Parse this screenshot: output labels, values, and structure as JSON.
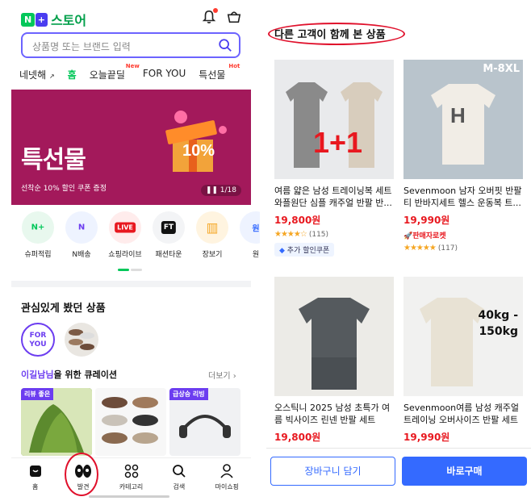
{
  "left": {
    "logo": {
      "badge": "N",
      "plus": "+",
      "text": "스토어"
    },
    "search": {
      "placeholder": "상품명 또는 브랜드 입력"
    },
    "tabs": [
      {
        "label": "네넷해",
        "active": false
      },
      {
        "label": "홈",
        "active": true
      },
      {
        "label": "오늘끝딜",
        "sup": "New",
        "active": false
      },
      {
        "label": "FOR YOU",
        "active": false
      },
      {
        "label": "특선물",
        "sup": "Hot",
        "active": false
      }
    ],
    "banner": {
      "title": "특선물",
      "subtitle": "선착순 10% 할인 쿠폰 증정",
      "pager": "1/18",
      "badge": "10%"
    },
    "quick": [
      {
        "icon": "N+",
        "label": "슈퍼적립"
      },
      {
        "icon": "N",
        "label": "N배송"
      },
      {
        "icon": "LIVE",
        "label": "쇼핑라이브"
      },
      {
        "icon": "FT",
        "label": "패션타운"
      },
      {
        "icon": "cart-icon",
        "label": "장보기"
      },
      {
        "icon": "원",
        "label": "원"
      }
    ],
    "section_title": "관심있게 봤던 상품",
    "foryou_label": "FOR YOU",
    "curation": {
      "name": "이길남님",
      "rest": "을 위한 큐레이션",
      "more": "더보기 ›"
    },
    "cards": [
      {
        "tag": "리뷰 좋은"
      },
      {
        "tag": ""
      },
      {
        "tag": "급상승 리빙"
      }
    ],
    "bottom_nav": [
      {
        "icon": "home-icon",
        "label": "홈"
      },
      {
        "icon": "eyes-icon",
        "label": "발견"
      },
      {
        "icon": "category-icon",
        "label": "카테고리"
      },
      {
        "icon": "search-icon",
        "label": "검색"
      },
      {
        "icon": "user-icon",
        "label": "마이쇼핑"
      }
    ]
  },
  "right": {
    "title": "다른 고객이 함께 본 상품",
    "products": [
      {
        "name": "여름 얇은 남성 트레이닝복 세트 와플원단 심플 캐주얼 반팔 반...",
        "price": "19,800원",
        "stars": "★★★★☆",
        "reviews": "(115)",
        "extra": "추가 할인쿠폰",
        "overlay": "1+1"
      },
      {
        "name": "Sevenmoon 남자 오버핏 반팔티 반바지세트 헬스 운동복 트...",
        "price": "19,990원",
        "rocket": "🚀판매자로켓",
        "stars": "★★★★★",
        "reviews": "(117)",
        "overlay": "M-8XL"
      },
      {
        "name": "오스틱니 2025 남성 초특가 여름 빅사이즈 린넨 반팔 세트",
        "price": "19,800원"
      },
      {
        "name": "Sevenmoon여름 남성 캐주얼 트레이닝 오버사이즈 반팔 세트",
        "price": "19,990원",
        "overlay1": "40kg -",
        "overlay2": "150kg"
      }
    ],
    "buttons": {
      "cart": "장바구니 담기",
      "buy": "바로구매"
    }
  }
}
